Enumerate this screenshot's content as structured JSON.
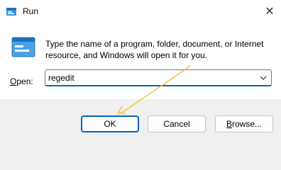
{
  "window": {
    "title": "Run",
    "close_glyph": "✕"
  },
  "dialog": {
    "description": "Type the name of a program, folder, document, or Internet resource, and Windows will open it for you.",
    "open_label_accel": "O",
    "open_label_rest": "pen:",
    "input_value": "regedit"
  },
  "buttons": {
    "ok": "OK",
    "cancel": "Cancel",
    "browse_accel": "B",
    "browse_rest": "rowse..."
  },
  "colors": {
    "accent": "#0067c0",
    "annotation_arrow": "#f5c242"
  },
  "icons": {
    "app": "run-icon",
    "dropdown": "chevron-down-icon",
    "close": "close-icon"
  }
}
